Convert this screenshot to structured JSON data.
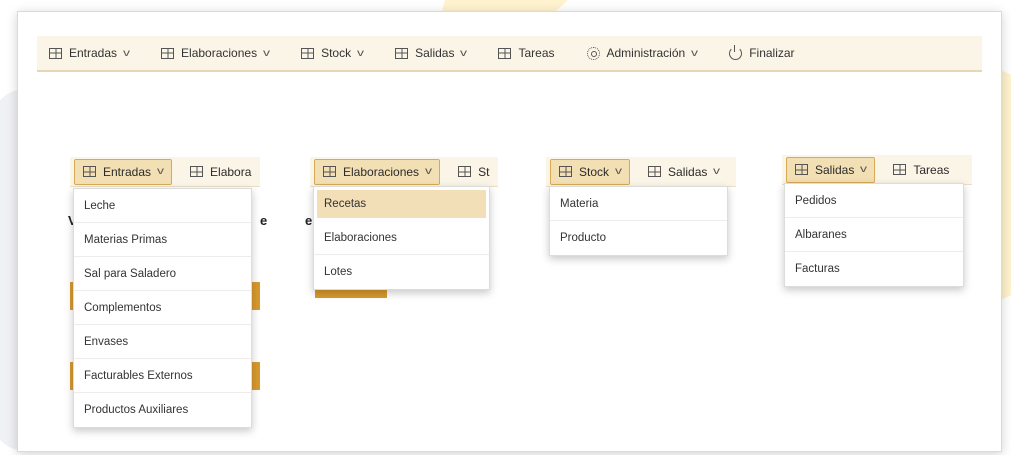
{
  "topnav": {
    "items": [
      {
        "label": "Entradas",
        "icon": "grid-icon",
        "dropdown": true
      },
      {
        "label": "Elaboraciones",
        "icon": "grid-icon",
        "dropdown": true
      },
      {
        "label": "Stock",
        "icon": "grid-icon",
        "dropdown": true
      },
      {
        "label": "Salidas",
        "icon": "grid-icon",
        "dropdown": true
      },
      {
        "label": "Tareas",
        "icon": "grid-icon",
        "dropdown": false
      },
      {
        "label": "Administración",
        "icon": "gear-icon",
        "dropdown": true
      },
      {
        "label": "Finalizar",
        "icon": "power-icon",
        "dropdown": false
      }
    ]
  },
  "panels": {
    "entradas": {
      "selected": "Entradas",
      "next": "Elabora",
      "items": [
        "Leche",
        "Materias Primas",
        "Sal para Saladero",
        "Complementos",
        "Envases",
        "Facturables Externos",
        "Productos Auxiliares"
      ]
    },
    "elaboraciones": {
      "selected": "Elaboraciones",
      "next": "St",
      "items": [
        "Recetas",
        "Elaboraciones",
        "Lotes"
      ],
      "active_item": "Recetas"
    },
    "stock": {
      "selected": "Stock",
      "next": "Salidas",
      "items": [
        "Materia",
        "Producto"
      ]
    },
    "salidas": {
      "selected": "Salidas",
      "next": "Tareas",
      "items": [
        "Pedidos",
        "Albaranes",
        "Facturas"
      ]
    }
  },
  "colors": {
    "nav_bg": "#fbf5e8",
    "selected_bg": "#f3dfb4",
    "selected_border": "#d7ab56",
    "accent_orange": "#d79a2d"
  }
}
